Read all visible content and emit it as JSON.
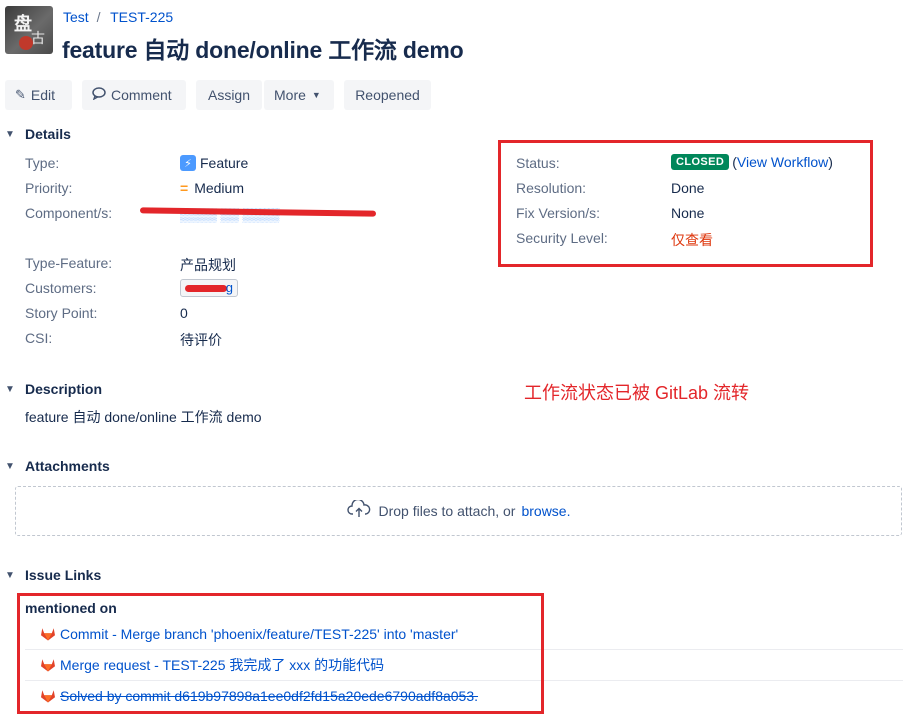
{
  "header": {
    "avatar_glyph_top": "盘",
    "avatar_glyph_bottom": "古",
    "breadcrumb": {
      "project": "Test",
      "separator": "/",
      "issue_key": "TEST-225"
    },
    "title": "feature 自动 done/online 工作流 demo"
  },
  "toolbar": {
    "edit": "Edit",
    "comment": "Comment",
    "assign": "Assign",
    "more": "More",
    "reopened": "Reopened"
  },
  "details": {
    "heading": "Details",
    "left": [
      {
        "label": "Type:",
        "value": "Feature",
        "icon": "feature-icon"
      },
      {
        "label": "Priority:",
        "value": "Medium",
        "icon": "medium-priority-icon"
      },
      {
        "label": "Component/s:",
        "value": "",
        "redacted": true
      },
      {
        "label": "Type-Feature:",
        "value": "产品规划"
      },
      {
        "label": "Customers:",
        "value": "g",
        "redacted": true
      },
      {
        "label": "Story Point:",
        "value": "0"
      },
      {
        "label": "CSI:",
        "value": "待评价"
      }
    ],
    "right": {
      "status_label": "Status:",
      "status_value": "CLOSED",
      "workflow_link": "View Workflow",
      "resolution_label": "Resolution:",
      "resolution_value": "Done",
      "fix_version_label": "Fix Version/s:",
      "fix_version_value": "None",
      "security_label": "Security Level:",
      "security_value": "仅查看"
    }
  },
  "annotation": {
    "text": "工作流状态已被 GitLab 流转",
    "color": "#e3262a"
  },
  "description": {
    "heading": "Description",
    "text": "feature 自动 done/online 工作流 demo"
  },
  "attachments": {
    "heading": "Attachments",
    "drop_text": "Drop files to attach, or",
    "browse": "browse."
  },
  "issue_links": {
    "heading": "Issue Links",
    "group": "mentioned on",
    "items": [
      {
        "text": "Commit - Merge branch 'phoenix/feature/TEST-225' into 'master'",
        "strike": false
      },
      {
        "text": "Merge request - TEST-225 我完成了 xxx 的功能代码",
        "strike": false
      },
      {
        "text": "Solved by commit d619b97898a1ee0df2fd15a20ede6790adf8a053.",
        "strike": true
      }
    ]
  },
  "colors": {
    "link": "#0052cc",
    "status_green": "#00875a",
    "annotation_red": "#e3262a"
  }
}
